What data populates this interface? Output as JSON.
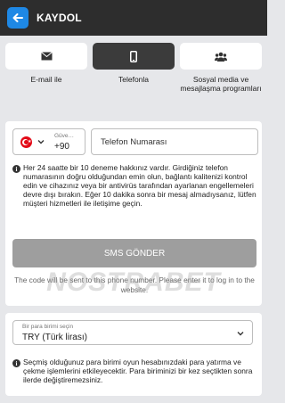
{
  "header": {
    "title": "KAYDOL"
  },
  "tabs": [
    {
      "label": "E-mail ile",
      "icon": "envelope-icon"
    },
    {
      "label": "Telefonla",
      "icon": "phone-icon",
      "active": true
    },
    {
      "label": "Sosyal media ve mesajlaşma programları",
      "icon": "users-icon"
    }
  ],
  "phone": {
    "country_label": "Güve…",
    "country_code": "+90",
    "placeholder": "Telefon Numarası"
  },
  "info_text": "Her 24 saatte bir 10 deneme hakkınız vardır. Girdiğiniz telefon numarasının doğru olduğundan emin olun, bağlantı kalitenizi kontrol edin ve cihazınız veya bir antivirüs tarafından ayarlanan engellemeleri devre dışı bırakın. Eğer 10 dakika sonra bir mesaj almadıysanız, lütfen müşteri hizmetleri ile iletişime geçin.",
  "sms_button": "SMS GÖNDER",
  "sms_note": "The code will be sent to this phone number. Please enter it to log in to the website.",
  "watermark": "NOSTRABET",
  "currency": {
    "label": "Bir para birimi seçin",
    "value": "TRY   (Türk lirası)",
    "info": "Seçmiş olduğunuz para birimi oyun hesabınızdaki para yatırma ve çekme işlemlerini etkileyecektir. Para biriminizi bir kez seçtikten sonra ilerde değiştiremezsiniz."
  },
  "colors": {
    "header_bg": "#2d2d2d",
    "accent": "#1e88e5",
    "active_tab": "#3b3b3b",
    "button_disabled": "#9e9e9e"
  }
}
